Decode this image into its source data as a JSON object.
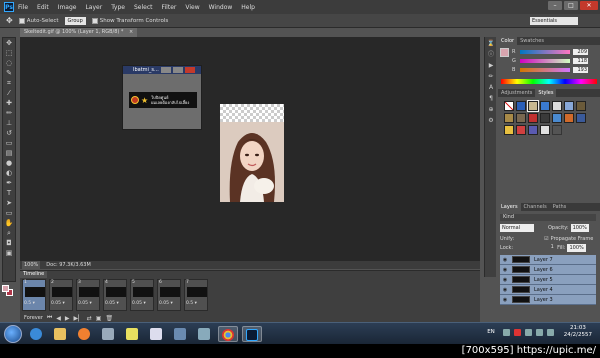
{
  "app": {
    "logo": "Ps"
  },
  "menu": [
    "File",
    "Edit",
    "Image",
    "Layer",
    "Type",
    "Select",
    "Filter",
    "View",
    "Window",
    "Help"
  ],
  "window_controls": {
    "minimize": "–",
    "restore": "□",
    "close": "✕"
  },
  "options": {
    "auto_select": "Auto-Select",
    "auto_select_target": "Group",
    "show_transform": "Show Transform Controls",
    "workspace": "Essentials"
  },
  "document": {
    "tab_title": "Skeltedit.gif @ 100% (Layer 1, RGB/8) *",
    "close": "×"
  },
  "mini_doc": {
    "title": "Ibatmi_s...",
    "banner_text_line1": "ใบปิดศูนย์",
    "banner_text_line2": "ผมเลยต้องกลับไปเลี้ยง"
  },
  "status": {
    "zoom": "100%",
    "doc_size": "Doc: 97.3K/3.63M"
  },
  "color_panel": {
    "tabs": [
      "Color",
      "Swatches"
    ],
    "r": {
      "label": "R",
      "value": "209"
    },
    "g": {
      "label": "G",
      "value": "118"
    },
    "b": {
      "label": "B",
      "value": "193"
    },
    "foreground": "#d8a4ae"
  },
  "adjust_panel": {
    "tabs": [
      "Adjustments",
      "Styles"
    ]
  },
  "layers_panel": {
    "tabs": [
      "Layers",
      "Channels",
      "Paths"
    ],
    "kind": "Kind",
    "blend_mode": "Normal",
    "opacity_label": "Opacity:",
    "opacity_value": "100%",
    "unify_label": "Unify:",
    "propagate": "Propagate Frame 1",
    "lock_label": "Lock:",
    "fill_label": "Fill:",
    "fill_value": "100%",
    "layers": [
      "Layer 7",
      "Layer 6",
      "Layer 5",
      "Layer 4",
      "Layer 3"
    ]
  },
  "timeline": {
    "tab": "Timeline",
    "frames": [
      {
        "num": "1",
        "delay": "0.5 ▾"
      },
      {
        "num": "2",
        "delay": "0.05 ▾"
      },
      {
        "num": "3",
        "delay": "0.05 ▾"
      },
      {
        "num": "4",
        "delay": "0.05 ▾"
      },
      {
        "num": "5",
        "delay": "0.05 ▾"
      },
      {
        "num": "6",
        "delay": "0.05 ▾"
      },
      {
        "num": "7",
        "delay": "0.5 ▾"
      }
    ],
    "loop": "Forever"
  },
  "taskbar": {
    "lang": "EN",
    "time": "21:03",
    "date": "24/2/2557"
  },
  "watermark": "[700x595] https://upic.me/"
}
